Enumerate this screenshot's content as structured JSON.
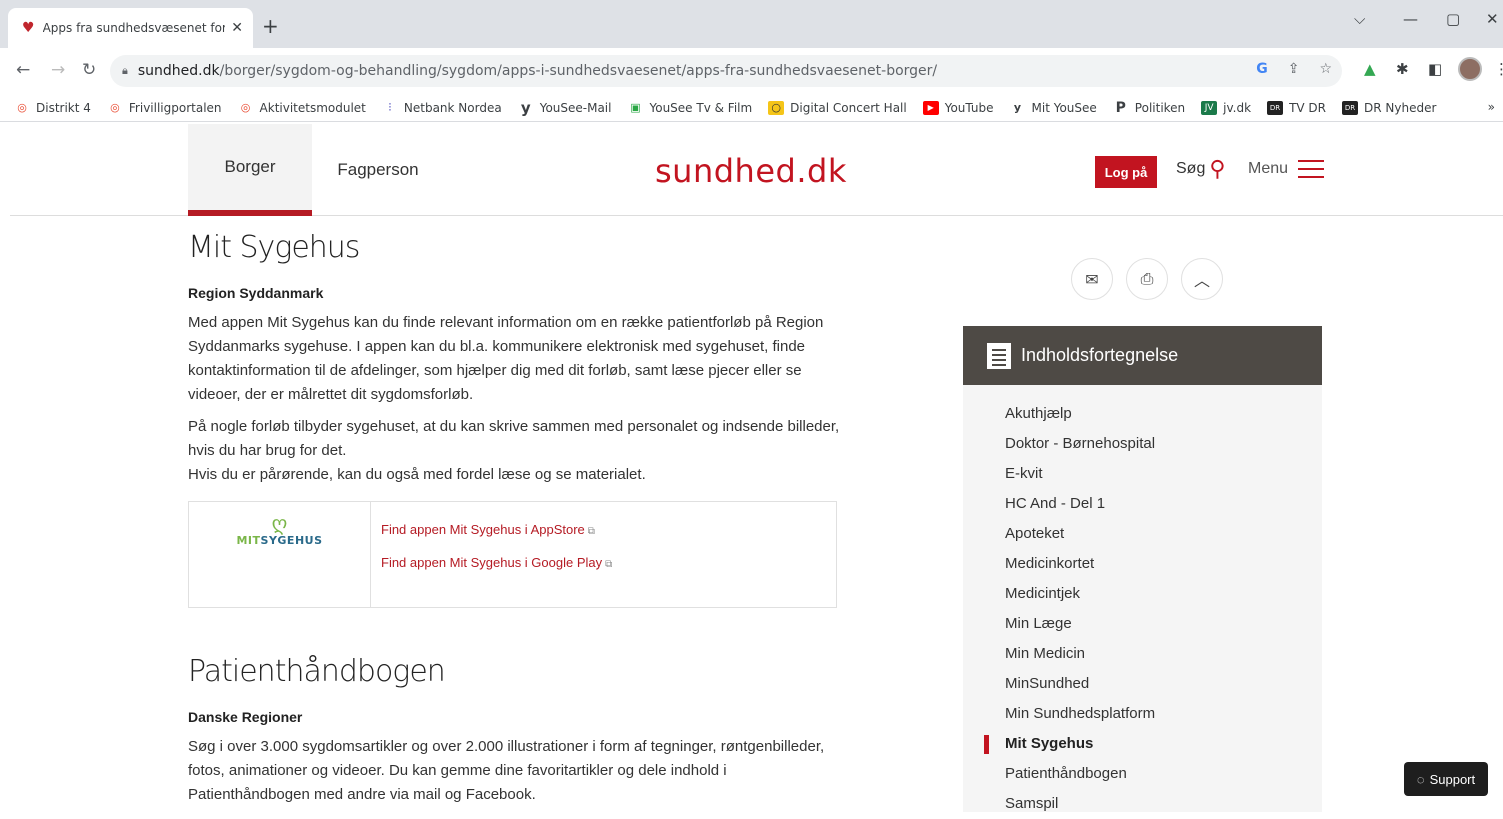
{
  "browser": {
    "tab_title": "Apps fra sundhedsvæsenet for b",
    "url_host": "sundhed.dk",
    "url_path": "/borger/sygdom-og-behandling/sygdom/apps-i-sundhedsvaesenet/apps-fra-sundhedsvaesenet-borger/",
    "bookmarks": [
      {
        "label": "Distrikt 4",
        "icon": "circle-red-icon"
      },
      {
        "label": "Frivilligportalen",
        "icon": "spiral-red-icon"
      },
      {
        "label": "Aktivitetsmodulet",
        "icon": "circle-red-icon"
      },
      {
        "label": "Netbank Nordea",
        "icon": "nordea-icon"
      },
      {
        "label": "YouSee-Mail",
        "icon": "yousee-icon"
      },
      {
        "label": "YouSee Tv & Film",
        "icon": "tv-icon"
      },
      {
        "label": "Digital Concert Hall",
        "icon": "concert-icon"
      },
      {
        "label": "YouTube",
        "icon": "youtube-icon"
      },
      {
        "label": "Mit YouSee",
        "icon": "yousee-icon"
      },
      {
        "label": "Politiken",
        "icon": "politiken-icon"
      },
      {
        "label": "jv.dk",
        "icon": "jv-icon"
      },
      {
        "label": "TV DR",
        "icon": "dr-icon"
      },
      {
        "label": "DR Nyheder",
        "icon": "dr-icon"
      }
    ],
    "bookmarks_more": "»"
  },
  "header": {
    "tab_borger": "Borger",
    "tab_fagperson": "Fagperson",
    "logo": "sundhed.dk",
    "login": "Log på",
    "search": "Søg",
    "menu": "Menu"
  },
  "section1": {
    "title": "Mit Sygehus",
    "subtitle": "Region Syddanmark",
    "p1": "Med appen Mit Sygehus kan du finde relevant information om en række patientforløb på Region Syddanmarks sygehuse. I appen kan du bl.a. kommunikere elektronisk med sygehuset, finde kontaktinformation til de afdelinger, som hjælper dig med dit forløb, samt læse pjecer eller se videoer, der er målrettet dit sygdomsforløb.",
    "p2a": "På nogle forløb tilbyder sygehuset, at du kan skrive sammen med personalet og indsende billeder, hvis du har brug for det.",
    "p2b": "Hvis du er pårørende, kan du også med fordel læse og se materialet.",
    "logo_mit": "MIT",
    "logo_sygehus": "SYGEHUS",
    "link_appstore": "Find appen Mit Sygehus i AppStore",
    "link_googleplay": "Find appen Mit Sygehus i Google Play"
  },
  "section2": {
    "title": "Patienthåndbogen",
    "subtitle": "Danske Regioner",
    "p1": "Søg i over 3.000 sygdomsartikler og over 2.000 illustrationer i form af tegninger, røntgenbilleder, fotos, animationer og videoer. Du kan gemme dine favoritartikler og dele indhold i Patienthåndbogen med andre via mail og Facebook."
  },
  "toc": {
    "title": "Indholdsfortegnelse",
    "items": [
      "Akuthjælp",
      "Doktor - Børnehospital",
      "E-kvit",
      "HC And - Del 1",
      "Apoteket",
      "Medicinkortet",
      "Medicintjek",
      "Min Læge",
      "Min Medicin",
      "MinSundhed",
      "Min Sundhedsplatform",
      "Mit Sygehus",
      "Patienthåndbogen",
      "Samspil"
    ],
    "active": "Mit Sygehus"
  },
  "support": "Support",
  "colors": {
    "brand_red": "#c21420",
    "toc_header": "#4e4a45"
  }
}
